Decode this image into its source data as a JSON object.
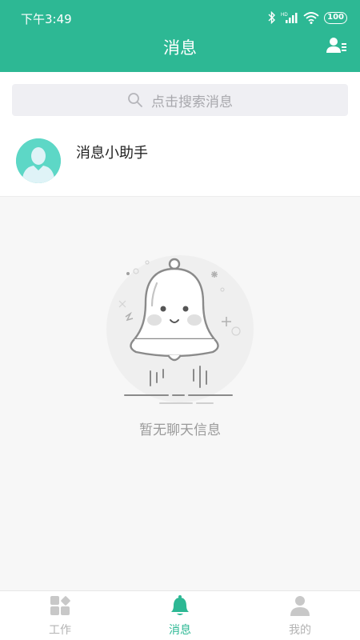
{
  "status_bar": {
    "time": "下午3:49",
    "battery": "100",
    "network": "HD"
  },
  "header": {
    "title": "消息"
  },
  "search": {
    "placeholder": "点击搜索消息"
  },
  "messages": [
    {
      "name": "消息小助手"
    }
  ],
  "empty_state": {
    "text": "暂无聊天信息"
  },
  "tabbar": {
    "items": [
      {
        "label": "工作",
        "icon": "grid-apps-icon",
        "active": false
      },
      {
        "label": "消息",
        "icon": "bell-icon",
        "active": true
      },
      {
        "label": "我的",
        "icon": "person-icon",
        "active": false
      }
    ]
  },
  "colors": {
    "primary": "#2db894",
    "tab_inactive": "#b3b3b3",
    "background": "#f7f7f7"
  }
}
